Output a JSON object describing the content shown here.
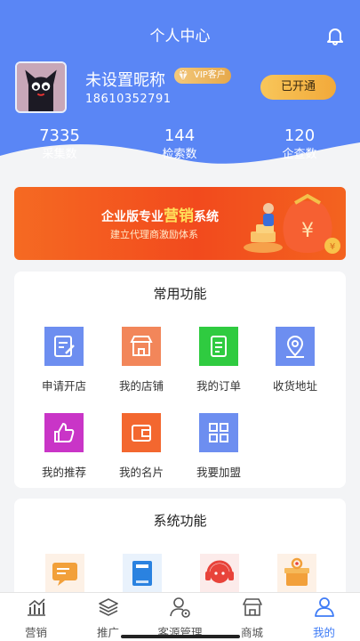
{
  "header": {
    "title": "个人中心",
    "bell_icon": "bell-icon"
  },
  "profile": {
    "nickname": "未设置昵称",
    "vip_badge": "VIP客户",
    "phone": "18610352791",
    "open_button": "已开通"
  },
  "stats": [
    {
      "value": "7335",
      "label": "采集数"
    },
    {
      "value": "144",
      "label": "检索数"
    },
    {
      "value": "120",
      "label": "企查数"
    }
  ],
  "banner": {
    "title_pre": "企业版专业",
    "title_highlight": "营销",
    "title_post": "系统",
    "subtitle": "建立代理商激励体系"
  },
  "common_functions": {
    "title": "常用功能",
    "items": [
      {
        "label": "申请开店",
        "icon": "edit-note-icon",
        "color": "#6d8ef0"
      },
      {
        "label": "我的店铺",
        "icon": "store-icon",
        "color": "#f2865a"
      },
      {
        "label": "我的订单",
        "icon": "document-icon",
        "color": "#2fcb40"
      },
      {
        "label": "收货地址",
        "icon": "location-pin-icon",
        "color": "#6d8ef0"
      },
      {
        "label": "我的推荐",
        "icon": "thumbs-up-icon",
        "color": "#c935c7"
      },
      {
        "label": "我的名片",
        "icon": "wallet-icon",
        "color": "#f3672f"
      },
      {
        "label": "我要加盟",
        "icon": "grid-apps-icon",
        "color": "#6d8ef0"
      }
    ]
  },
  "system_functions": {
    "title": "系统功能",
    "items": [
      {
        "icon": "message-icon",
        "color": "#f2a03a"
      },
      {
        "icon": "book-icon",
        "color": "#2a82e0"
      },
      {
        "icon": "customer-service-icon",
        "color": "#e8433a"
      },
      {
        "icon": "settings-gift-icon",
        "color": "#f2a03a"
      }
    ]
  },
  "bottom_nav": [
    {
      "label": "营销",
      "icon": "chart-icon",
      "active": false
    },
    {
      "label": "推广",
      "icon": "layers-icon",
      "active": false
    },
    {
      "label": "客源管理",
      "icon": "user-settings-icon",
      "active": false
    },
    {
      "label": "商城",
      "icon": "shop-icon",
      "active": false
    },
    {
      "label": "我的",
      "icon": "person-icon",
      "active": true
    }
  ],
  "colors": {
    "primary": "#5a86f5",
    "accent": "#3f7cf6",
    "gold": "#f2a93a"
  }
}
